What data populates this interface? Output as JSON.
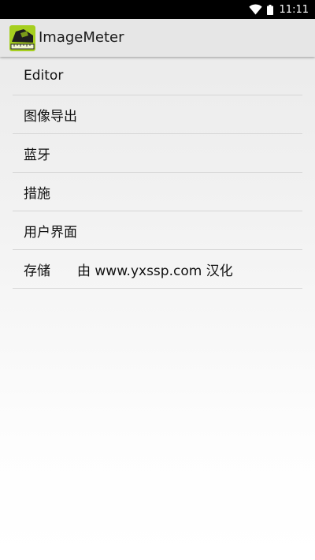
{
  "status_bar": {
    "time": "11:11",
    "icons": [
      "wifi-icon",
      "battery-icon"
    ]
  },
  "app": {
    "title": "ImageMeter",
    "icon": "image-meter-app-icon",
    "accent_color": "#a6cf1f"
  },
  "menu": {
    "items": [
      {
        "label": "Editor"
      },
      {
        "label": "图像导出"
      },
      {
        "label": "蓝牙"
      },
      {
        "label": "措施"
      },
      {
        "label": "用户界面"
      },
      {
        "label": "存储",
        "credit": "由 www.yxssp.com 汉化"
      }
    ]
  }
}
